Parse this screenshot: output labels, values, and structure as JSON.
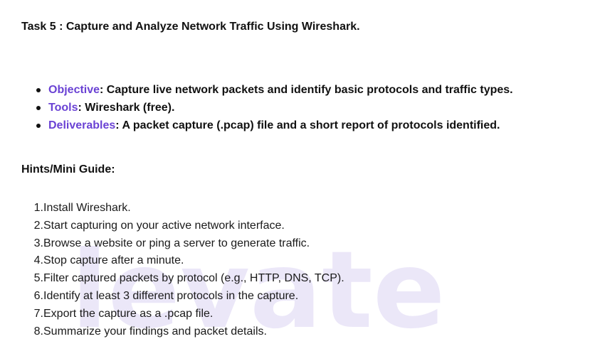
{
  "task_title": "Task 5  : Capture and Analyze Network Traffic Using Wireshark.",
  "overview": [
    {
      "term": "Objective",
      "text": ": Capture live network packets and identify basic protocols and traffic types."
    },
    {
      "term": "Tools",
      "text": ": Wireshark (free)."
    },
    {
      "term": "Deliverables",
      "text": ":  A packet capture (.pcap) file and a short report of protocols identified."
    }
  ],
  "guide_heading": "Hints/Mini Guide:",
  "steps": [
    {
      "num": "1.",
      "text": "Install Wireshark."
    },
    {
      "num": "2.",
      "text": "Start capturing on your active network interface."
    },
    {
      "num": "3.",
      "text": "Browse a website or ping a server to generate traffic."
    },
    {
      "num": "4.",
      "text": "Stop capture after a minute."
    },
    {
      "num": "5.",
      "text": "Filter captured packets by protocol (e.g., HTTP, DNS, TCP)."
    },
    {
      "num": "6.",
      "text": "Identify at least 3 different protocols in the capture."
    },
    {
      "num": "7.",
      "text": "Export the capture as a .pcap file."
    },
    {
      "num": "8.",
      "text": "Summarize your findings and packet details."
    }
  ],
  "colors": {
    "term": "#6a42d4",
    "watermark": "#6d4bd1"
  }
}
